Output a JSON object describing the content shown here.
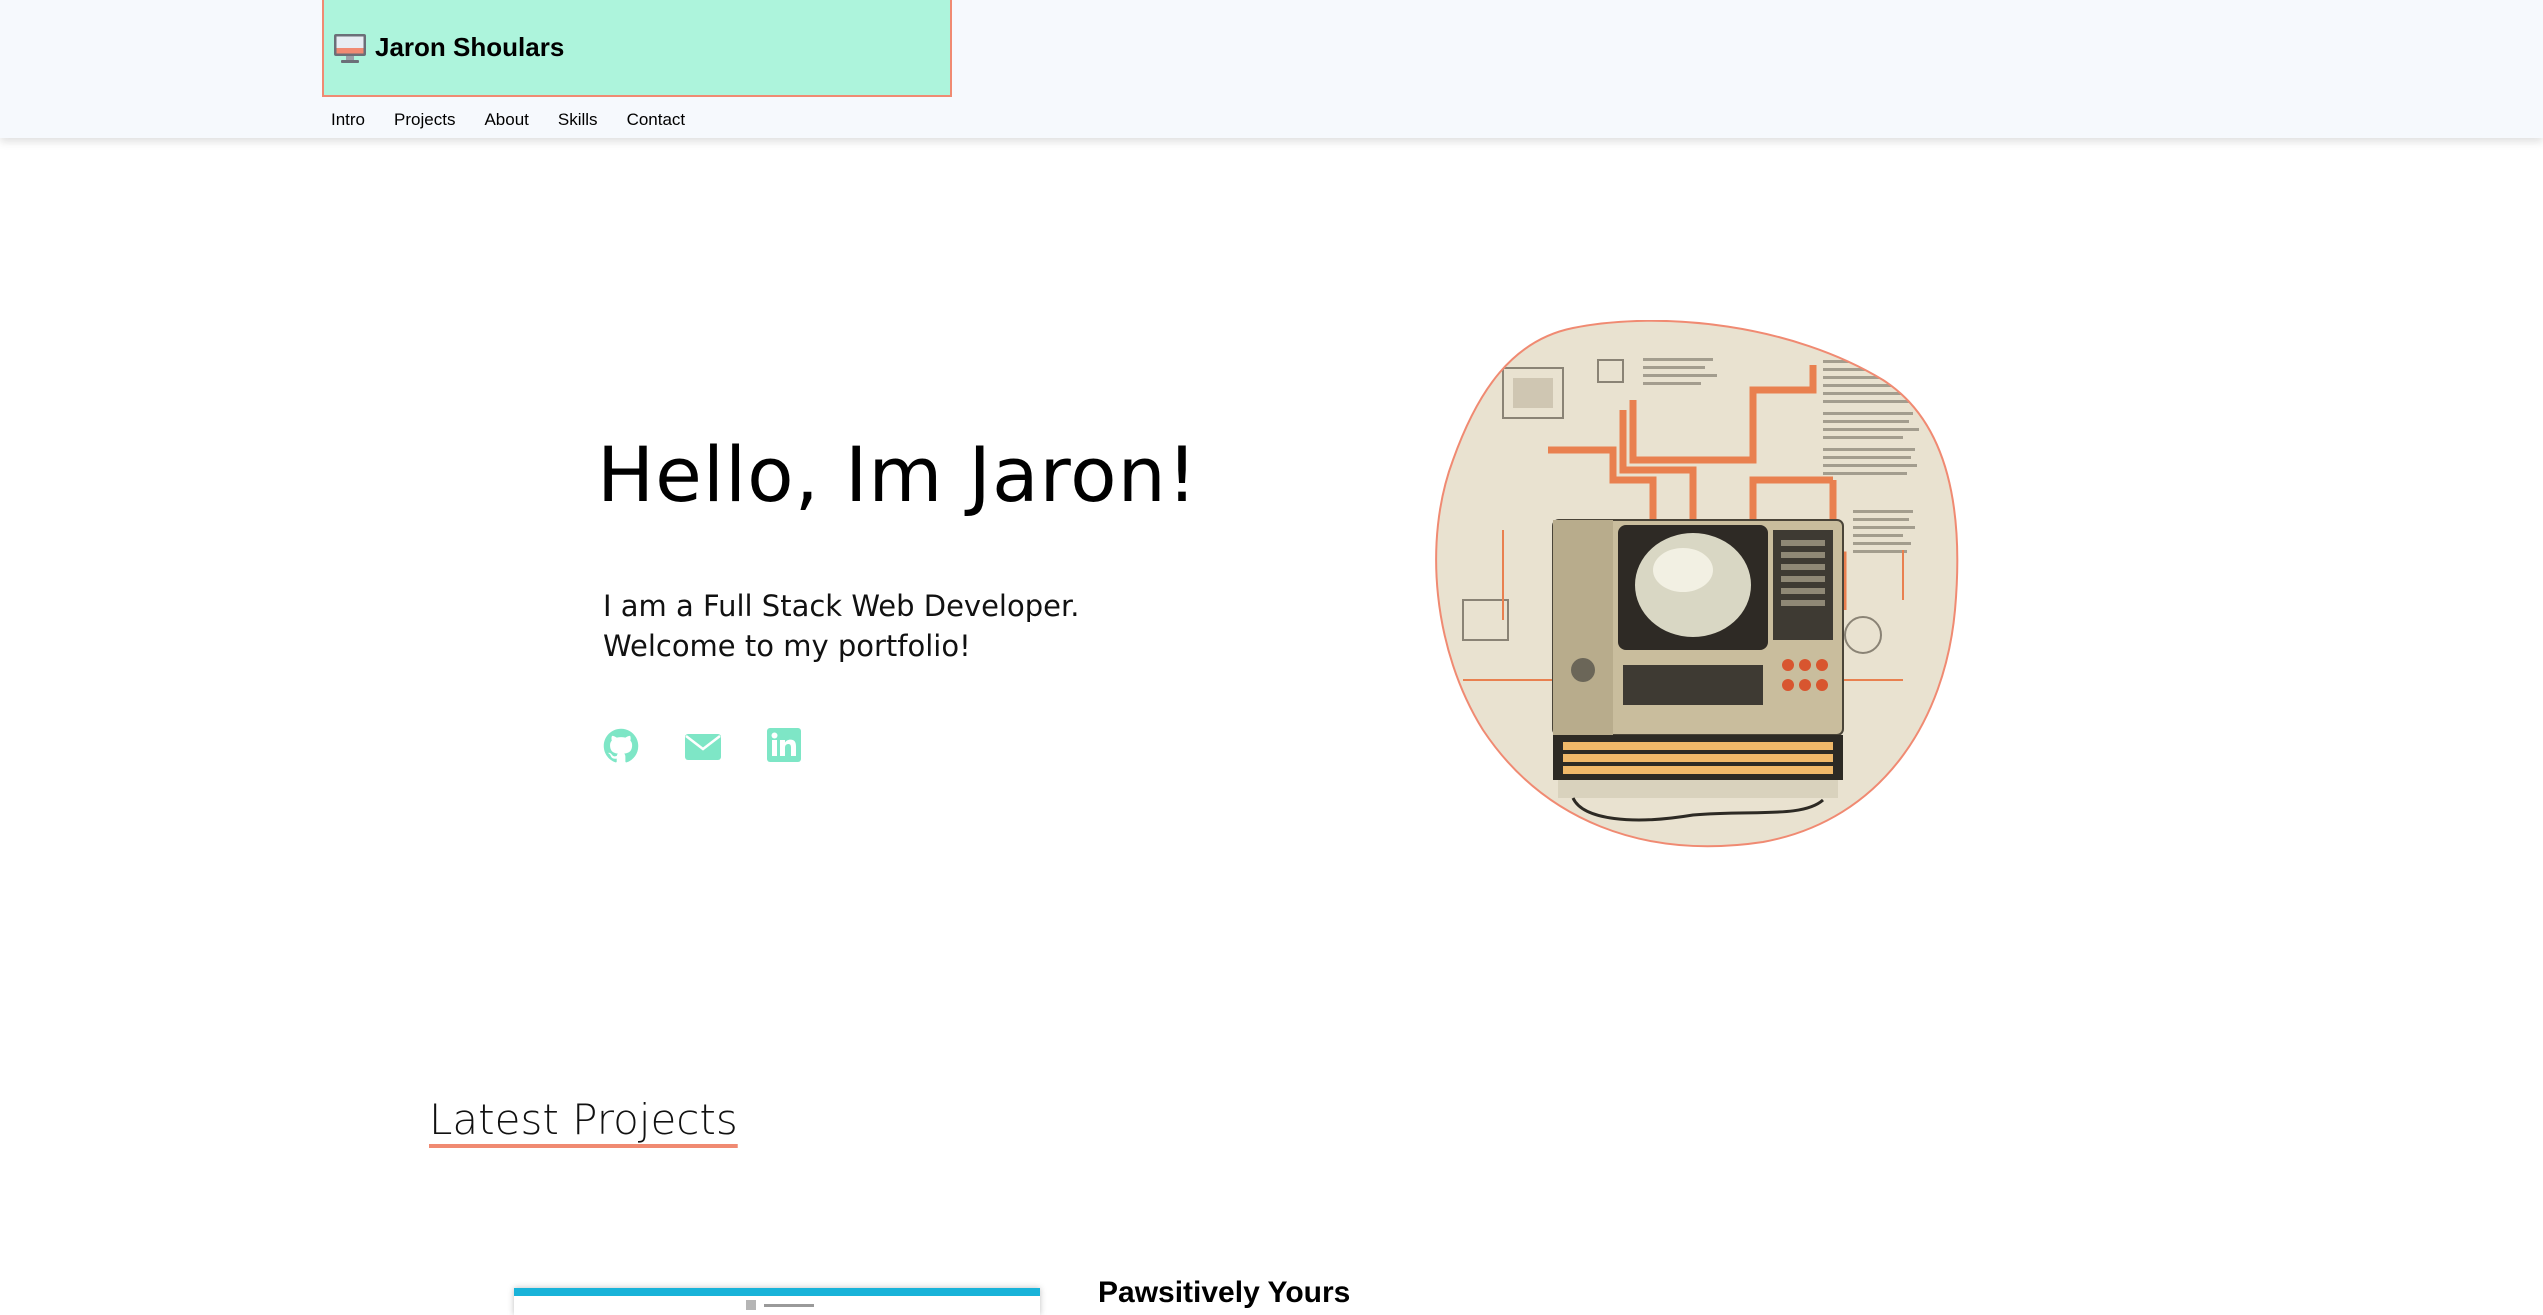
{
  "header": {
    "brand_name": "Jaron Shoulars",
    "brand_icon": "computer-icon",
    "nav": [
      {
        "label": "Intro"
      },
      {
        "label": "Projects"
      },
      {
        "label": "About"
      },
      {
        "label": "Skills"
      },
      {
        "label": "Contact"
      }
    ]
  },
  "hero": {
    "title": "Hello, Im Jaron!",
    "subtitle_line1": "I am a Full Stack Web Developer.",
    "subtitle_line2": "Welcome to my portfolio!",
    "social_icons": [
      "github-icon",
      "email-icon",
      "linkedin-icon"
    ],
    "illustration": "retro-computer-illustration"
  },
  "projects": {
    "section_title": "Latest Projects",
    "items": [
      {
        "name": "Pawsitively Yours"
      }
    ]
  },
  "colors": {
    "accent_mint": "#adf4dc",
    "accent_coral": "#f08a72",
    "header_bg": "#f6f9fd",
    "social_icon": "#7ee6c6"
  }
}
